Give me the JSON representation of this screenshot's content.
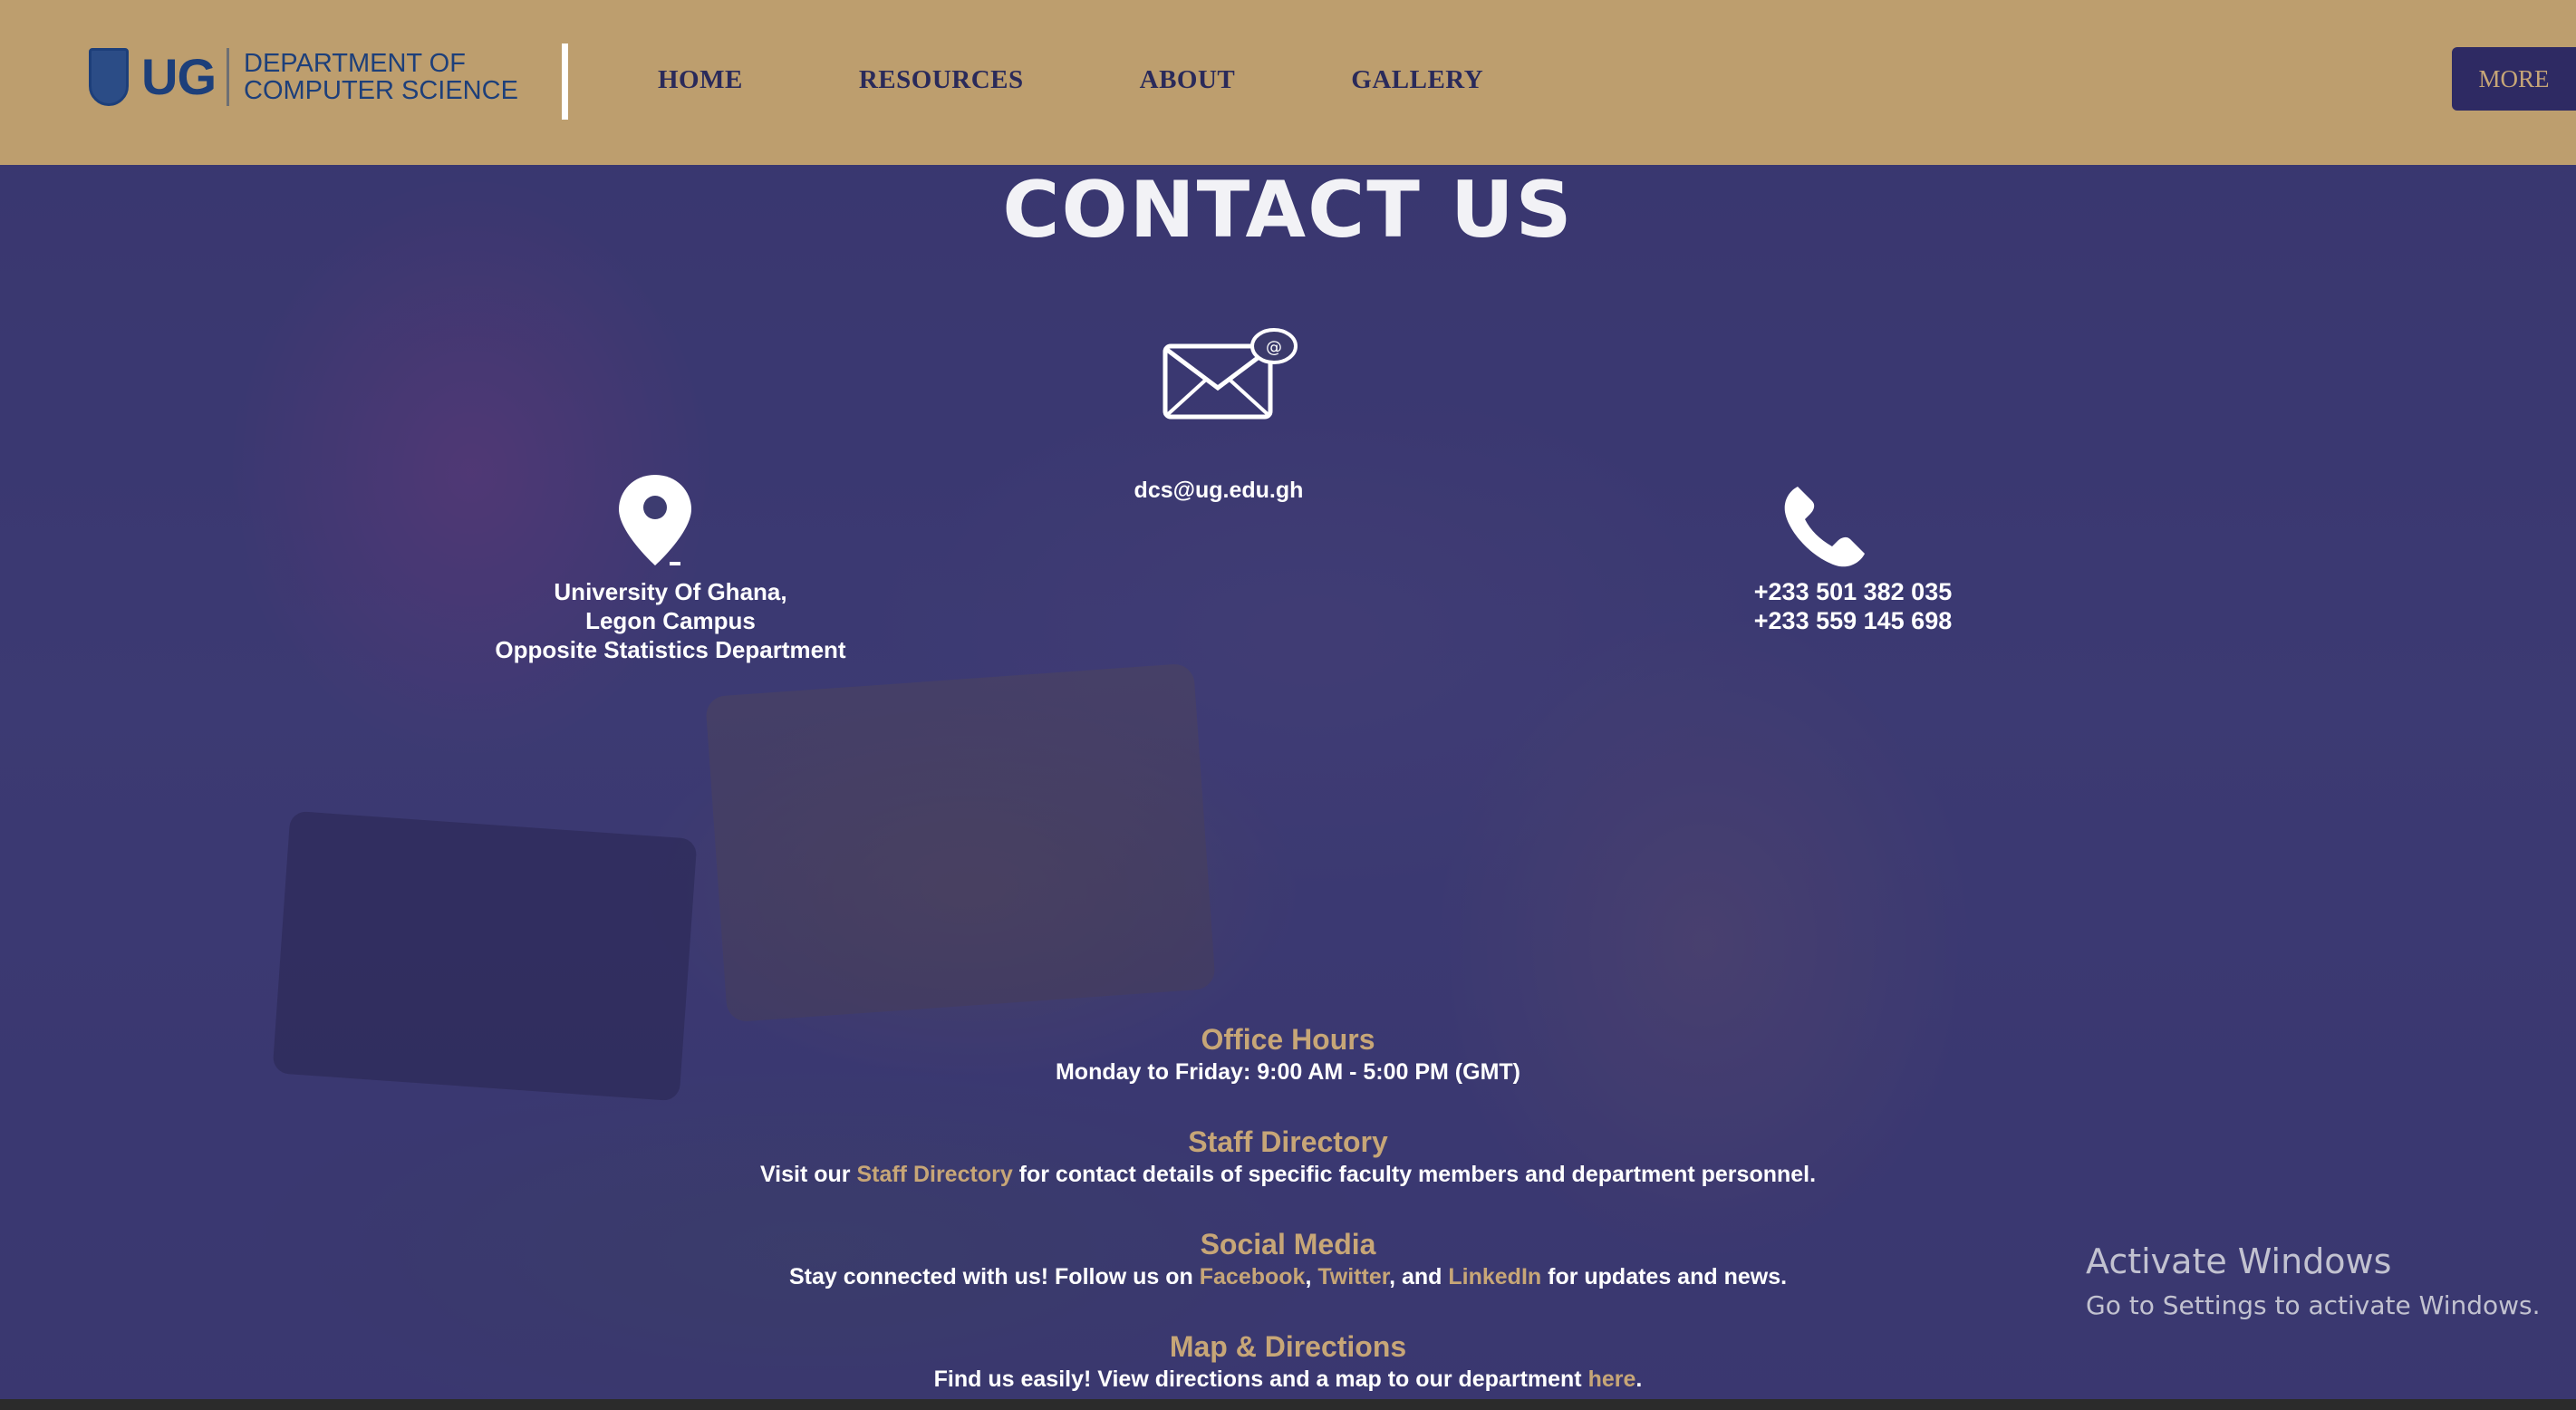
{
  "header": {
    "logo_ug": "UG",
    "logo_line1": "DEPARTMENT OF",
    "logo_line2": "COMPUTER SCIENCE",
    "nav": [
      "HOME",
      "RESOURCES",
      "ABOUT",
      "GALLERY"
    ],
    "more_label": "MORE"
  },
  "main": {
    "title": "CONTACT US",
    "email": "dcs@ug.edu.gh",
    "location": [
      "University Of Ghana,",
      "Legon Campus",
      "Opposite Statistics Department"
    ],
    "phones": [
      "+233 501 382 035",
      "+233 559 145 698"
    ]
  },
  "info": {
    "office_hours": {
      "heading": "Office Hours",
      "text": "Monday to Friday: 9:00 AM - 5:00 PM (GMT)"
    },
    "staff_directory": {
      "heading": "Staff Directory",
      "pre": "Visit our ",
      "link": "Staff Directory",
      "post": " for contact details of specific faculty members and department personnel."
    },
    "social_media": {
      "heading": "Social Media",
      "pre": "Stay connected with us! Follow us on ",
      "link1": "Facebook",
      "sep1": ", ",
      "link2": "Twitter",
      "sep2": ", and ",
      "link3": "LinkedIn",
      "post": " for updates and news."
    },
    "map": {
      "heading": "Map & Directions",
      "pre": "Find us easily! View directions and a map to our department ",
      "link": "here",
      "post": "."
    }
  },
  "watermark": {
    "line1": "Activate Windows",
    "line2": "Go to Settings to activate Windows."
  },
  "colors": {
    "header_bg": "#bd9e6e",
    "accent_gold": "#c7a677",
    "navy": "#2e2a63"
  }
}
